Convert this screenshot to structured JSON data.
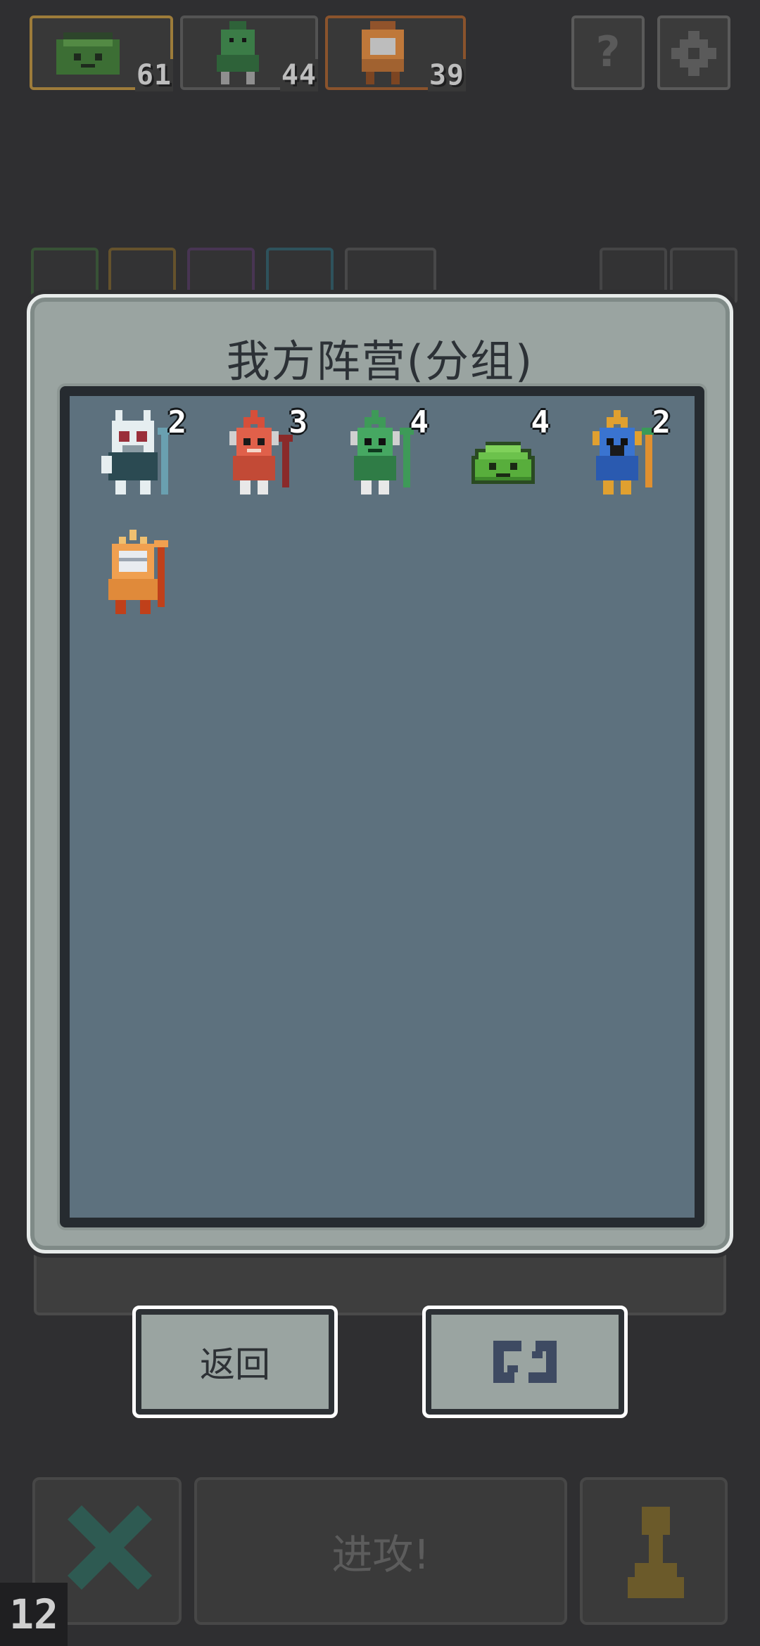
{
  "factions": [
    {
      "name": "slime",
      "count": "61",
      "color": "#b18a3c"
    },
    {
      "name": "fishman",
      "count": "44",
      "color": "#4f4f4f"
    },
    {
      "name": "dragon",
      "count": "39",
      "color": "#9b5a2c"
    }
  ],
  "top_buttons": {
    "help": "?",
    "settings": "gear"
  },
  "panel": {
    "title": "我方阵营(分组)",
    "units": [
      {
        "name": "skull-knight",
        "level": "2"
      },
      {
        "name": "red-fishman",
        "level": "3"
      },
      {
        "name": "green-fishman",
        "level": "4"
      },
      {
        "name": "green-slime",
        "level": "4"
      },
      {
        "name": "blue-fishman",
        "level": "2"
      },
      {
        "name": "orange-dragon",
        "level": ""
      }
    ]
  },
  "buttons": {
    "back": "返回",
    "refresh": "refresh-icon"
  },
  "bottom": {
    "attack": "进攻!",
    "round": "12"
  }
}
